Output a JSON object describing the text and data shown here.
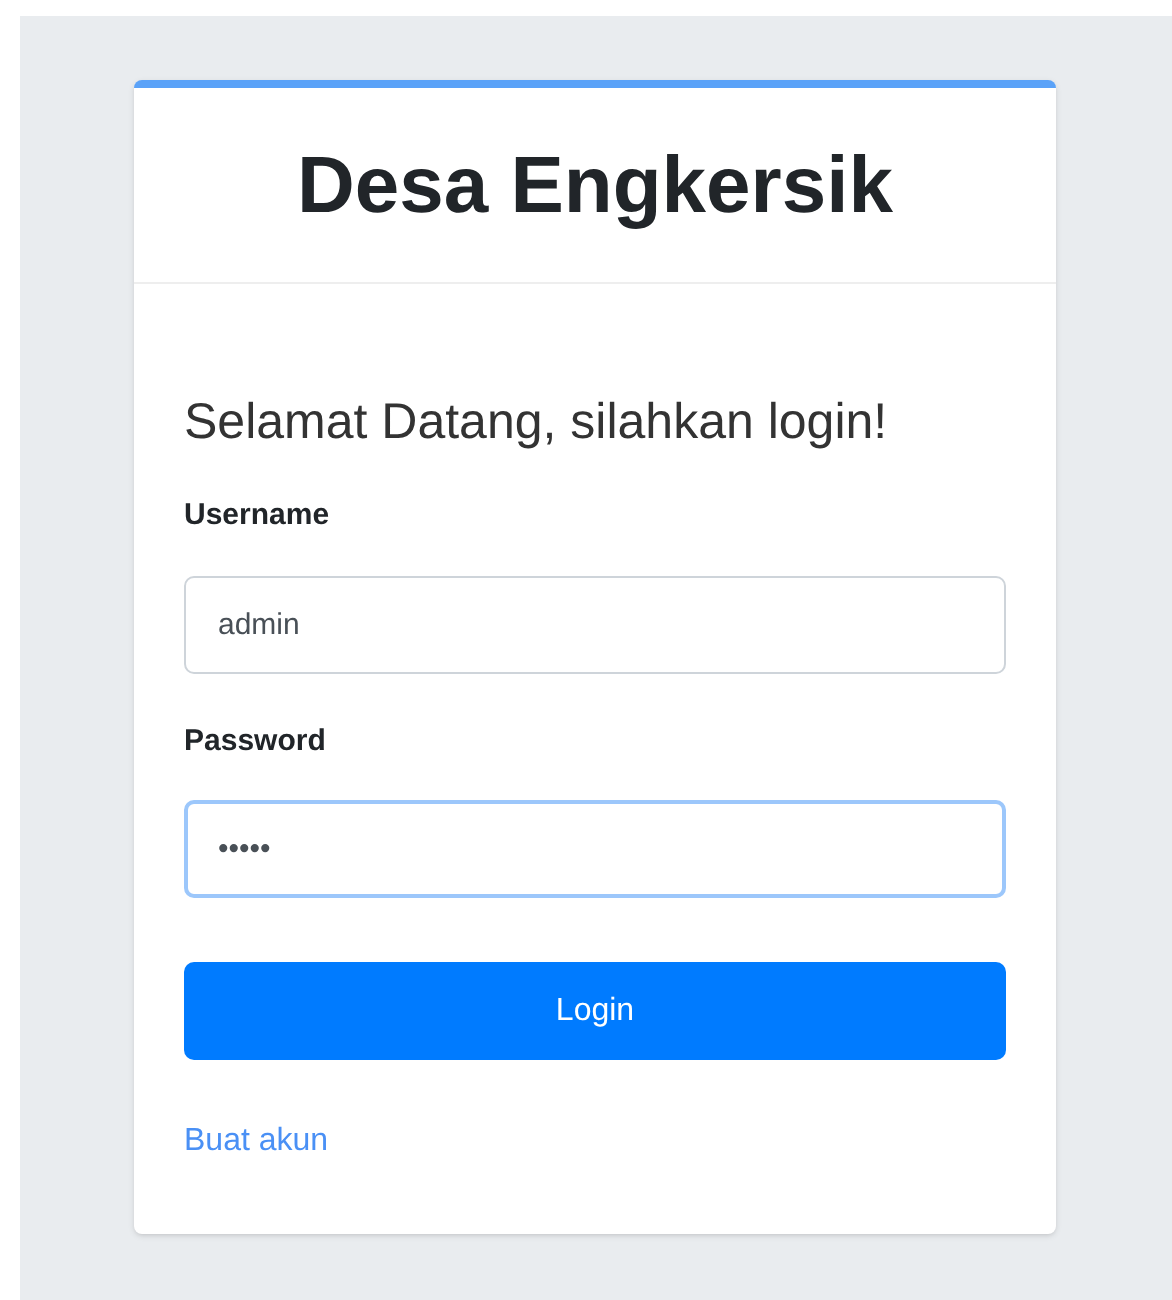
{
  "header": {
    "title": "Desa Engkersik"
  },
  "greeting": "Selamat Datang, silahkan login!",
  "fields": [
    {
      "label": "Username",
      "value": "admin",
      "focused": false
    },
    {
      "label": "Password",
      "value": "•••••",
      "focused": true
    }
  ],
  "button": "Login",
  "link": "Buat akun"
}
